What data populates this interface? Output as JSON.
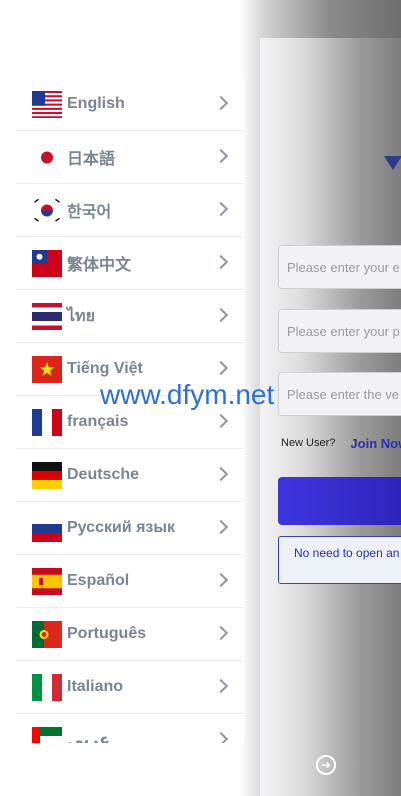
{
  "drawer": {
    "languages": [
      {
        "label": "English",
        "flag": "us-flag"
      },
      {
        "label": "日本語",
        "flag": "jp-flag"
      },
      {
        "label": "한국어",
        "flag": "kr-flag"
      },
      {
        "label": "繁体中文",
        "flag": "tw-flag"
      },
      {
        "label": "ไทย",
        "flag": "th-flag"
      },
      {
        "label": "Tiếng Việt",
        "flag": "vn-flag"
      },
      {
        "label": "français",
        "flag": "fr-flag"
      },
      {
        "label": "Deutsche",
        "flag": "de-flag"
      },
      {
        "label": "Русский язык",
        "flag": "ru-flag"
      },
      {
        "label": "Español",
        "flag": "es-flag"
      },
      {
        "label": "Português",
        "flag": "pt-flag"
      },
      {
        "label": "Italiano",
        "flag": "it-flag"
      },
      {
        "label": "عربى",
        "flag": "ae-flag"
      }
    ]
  },
  "login": {
    "email_placeholder": "Please enter your e",
    "password_placeholder": "Please enter your p",
    "verify_placeholder": "Please enter the ve",
    "new_user_label": "New User?",
    "join_label": "Join Now",
    "notice_text": "No need to open an"
  },
  "watermark": "www.dfym.net",
  "colors": {
    "accent": "#2b2fb0",
    "button": "#3f35e0",
    "label": "#7a8593"
  }
}
